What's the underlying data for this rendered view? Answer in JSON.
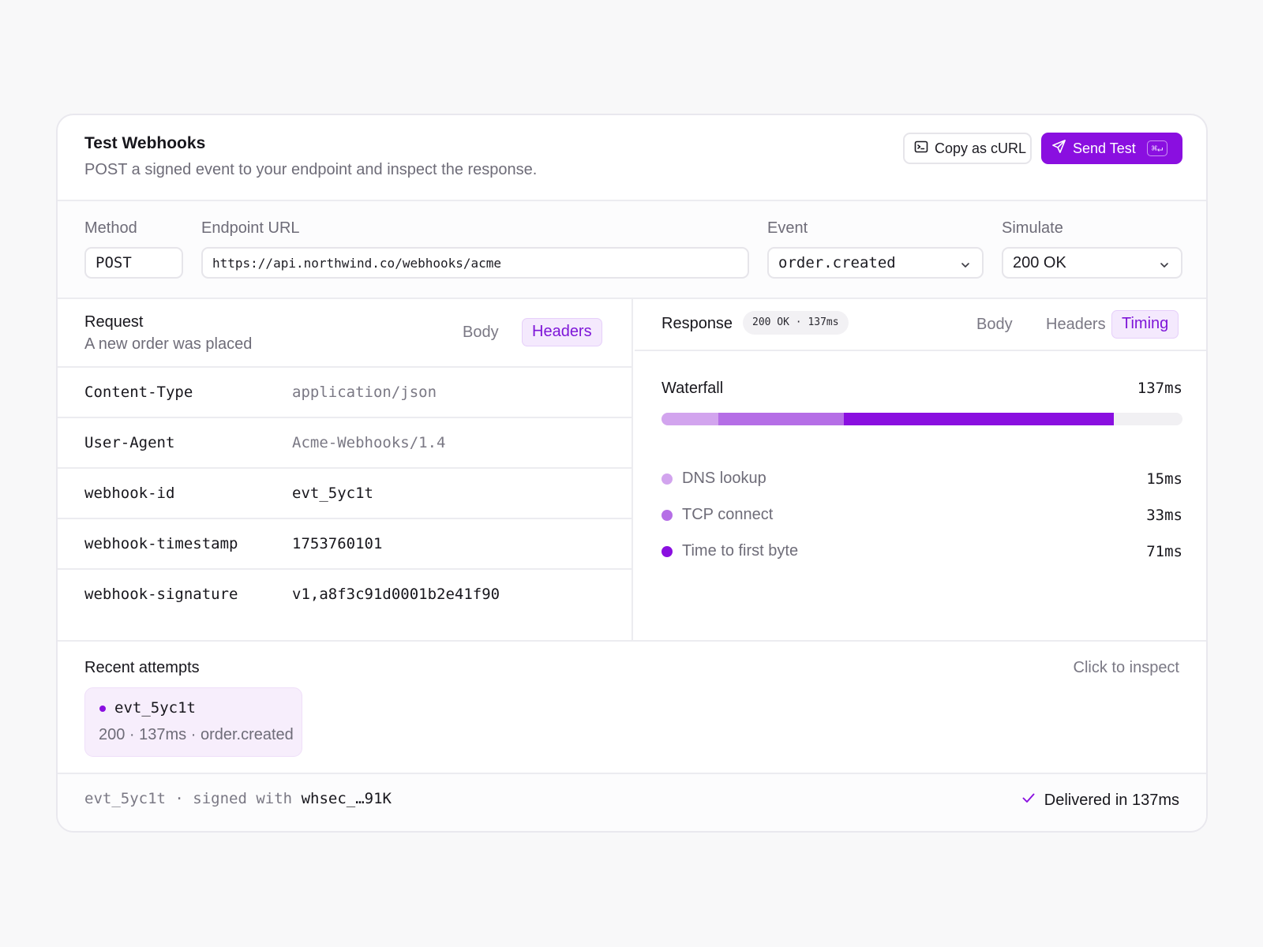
{
  "header": {
    "title": "Test Webhooks",
    "subtitle": "POST a signed event to your endpoint and inspect the response.",
    "copy_curl_label": "Copy as cURL",
    "send_test_label": "Send Test",
    "send_shortcut": "⌘↵"
  },
  "form": {
    "method_label": "Method",
    "method_value": "POST",
    "endpoint_label": "Endpoint URL",
    "endpoint_value": "https://api.northwind.co/webhooks/acme",
    "event_label": "Event",
    "event_value": "order.created",
    "simulate_label": "Simulate",
    "simulate_value": "200 OK"
  },
  "request": {
    "title": "Request",
    "subtitle": "A new order was placed",
    "tabs": [
      "Body",
      "Headers"
    ],
    "active_tab": "Headers",
    "headers": [
      {
        "key": "Content-Type",
        "value": "application/json"
      },
      {
        "key": "User-Agent",
        "value": "Acme-Webhooks/1.4"
      },
      {
        "key": "webhook-id",
        "value": "evt_5yc1t"
      },
      {
        "key": "webhook-timestamp",
        "value": "1753760101"
      },
      {
        "key": "webhook-signature",
        "value": "v1,a8f3c91d0001b2e41f90"
      }
    ]
  },
  "response": {
    "title": "Response",
    "badge": "200 OK · 137ms",
    "tabs": [
      "Body",
      "Headers",
      "Timing"
    ],
    "active_tab": "Timing",
    "waterfall_title": "Waterfall",
    "total": "137ms",
    "total_ms": 137,
    "phases": [
      {
        "name": "DNS lookup",
        "ms_label": "15ms",
        "ms": 15,
        "color": "#d2a4ee"
      },
      {
        "name": "TCP connect",
        "ms_label": "33ms",
        "ms": 33,
        "color": "#b56ee6"
      },
      {
        "name": "Time to first byte",
        "ms_label": "71ms",
        "ms": 71,
        "color": "#8a0fe0"
      }
    ]
  },
  "recent": {
    "title": "Recent attempts",
    "hint": "Click to inspect",
    "attempt_id": "evt_5yc1t",
    "attempt_meta": "200 · 137ms · order.created"
  },
  "footer": {
    "event_id": "evt_5yc1t",
    "signed_text": "· signed with",
    "secret": "whsec_…91K",
    "delivered": "Delivered in 137ms"
  },
  "colors": {
    "accent": "#8a0fe0",
    "accent_soft": "#f4e9fd",
    "muted_text": "#6e6c78"
  }
}
